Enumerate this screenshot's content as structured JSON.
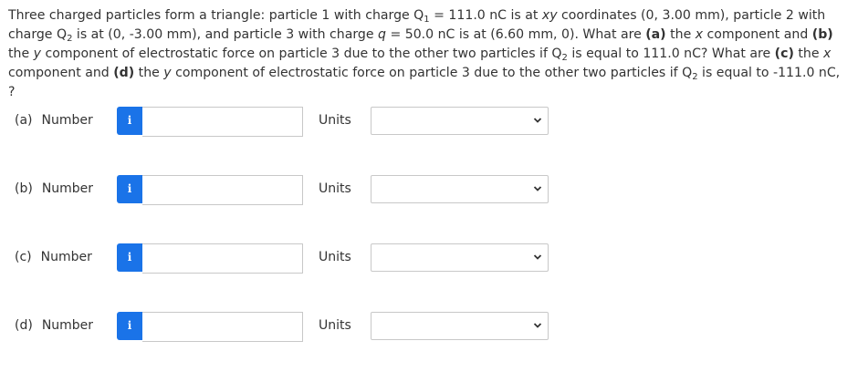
{
  "question": {
    "t1": "Three charged particles form a triangle: particle 1 with charge Q",
    "s1": "1",
    "t2": " = 111.0 nC is at ",
    "t3": "xy",
    "t4": " coordinates (0, 3.00 mm), particle 2 with charge Q",
    "s2": "2",
    "t5": " is at (0, -3.00 mm), and particle 3 with charge ",
    "t6": "q",
    "t7": " = 50.0 nC is at (6.60 mm, 0). What are ",
    "b1": "(a)",
    "t8": " the ",
    "t9": "x",
    "t10": " component and ",
    "b2": "(b)",
    "t11": " the ",
    "t12": "y",
    "t13": " component of electrostatic force on particle 3 due to the other two particles if Q",
    "s3": "2",
    "t14": " is equal to 111.0 nC? What are ",
    "b3": "(c)",
    "t15": " the ",
    "t16": "x",
    "t17": " component and ",
    "b4": "(d)",
    "t18": " the ",
    "t19": "y",
    "t20": " component of electrostatic force on particle 3 due to the other two particles if Q",
    "s4": "2",
    "t21": " is equal to -111.0 nC, ?"
  },
  "rows": [
    {
      "part": "(a)",
      "number_label": "Number",
      "info": "i",
      "value": "",
      "units_label": "Units",
      "units_selected": ""
    },
    {
      "part": "(b)",
      "number_label": "Number",
      "info": "i",
      "value": "",
      "units_label": "Units",
      "units_selected": ""
    },
    {
      "part": "(c)",
      "number_label": "Number",
      "info": "i",
      "value": "",
      "units_label": "Units",
      "units_selected": ""
    },
    {
      "part": "(d)",
      "number_label": "Number",
      "info": "i",
      "value": "",
      "units_label": "Units",
      "units_selected": ""
    }
  ],
  "colors": {
    "accent": "#1a73e8",
    "text": "#333333",
    "border": "#c8c8c8"
  },
  "icons": {
    "info": "info-icon",
    "dropdown": "chevron-down-icon"
  }
}
